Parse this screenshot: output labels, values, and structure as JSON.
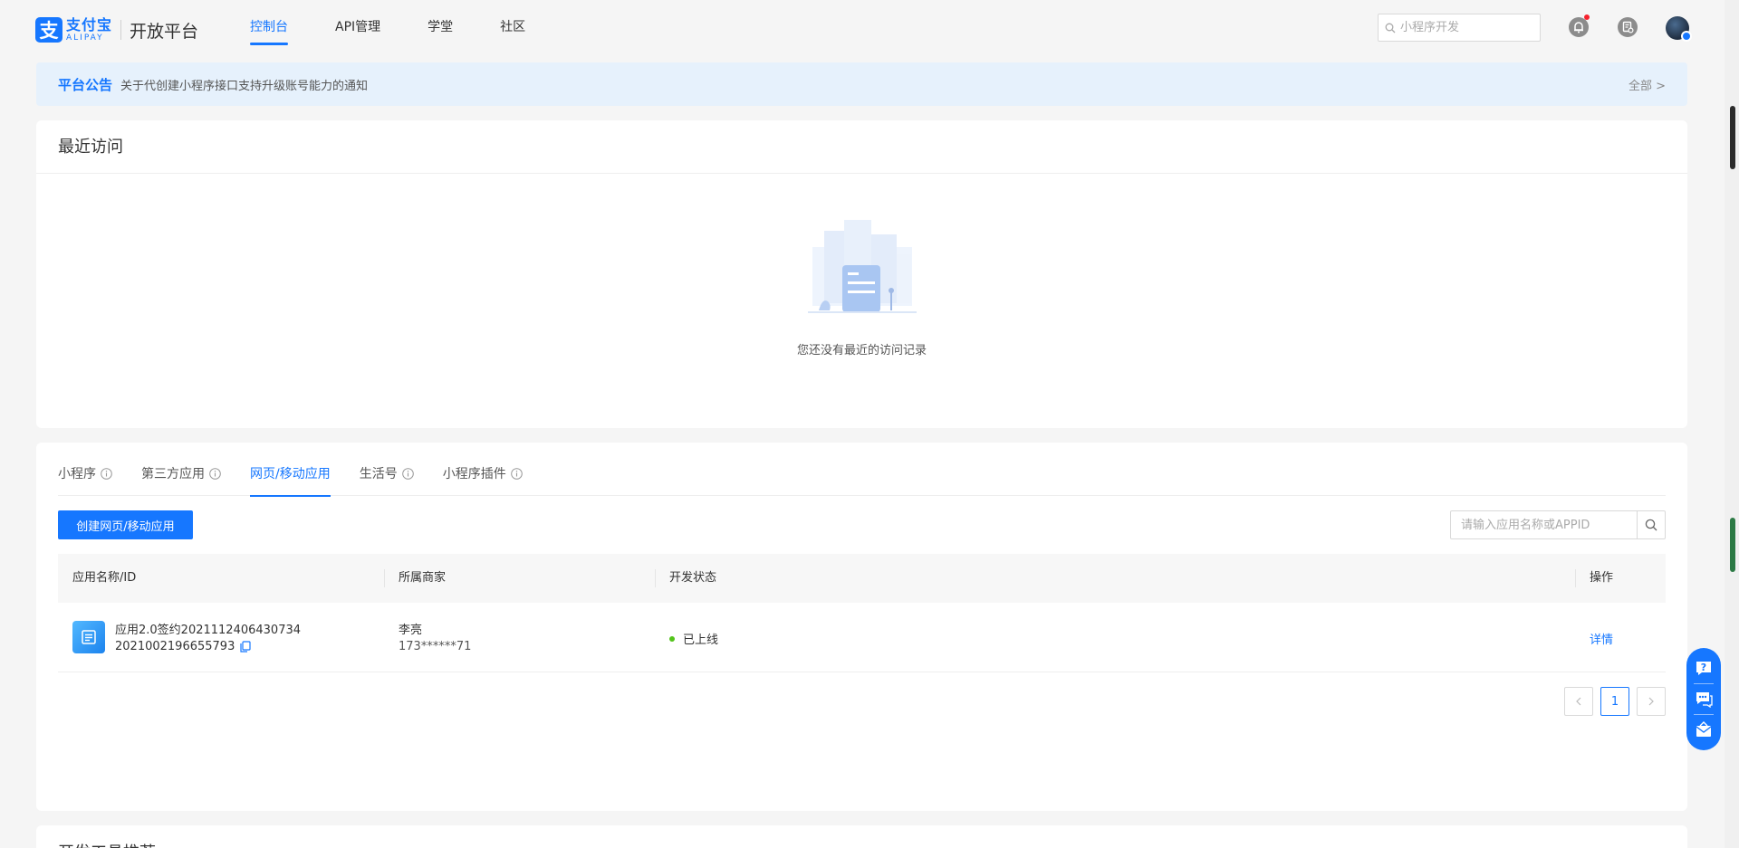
{
  "header": {
    "logo_cn": "支付宝",
    "logo_en": "ALIPAY",
    "logo_badge": "支",
    "platform": "开放平台",
    "nav": [
      {
        "label": "控制台",
        "active": true
      },
      {
        "label": "API管理",
        "active": false
      },
      {
        "label": "学堂",
        "active": false
      },
      {
        "label": "社区",
        "active": false
      }
    ],
    "search_placeholder": "小程序开发",
    "icons": [
      "bell-icon",
      "document-icon",
      "avatar"
    ]
  },
  "notice": {
    "label": "平台公告",
    "text": "关于代创建小程序接口支持升级账号能力的通知",
    "all": "全部 >"
  },
  "recent": {
    "title": "最近访问",
    "empty_text": "您还没有最近的访问记录"
  },
  "apps": {
    "tabs": [
      {
        "label": "小程序",
        "info": true,
        "active": false
      },
      {
        "label": "第三方应用",
        "info": true,
        "active": false
      },
      {
        "label": "网页/移动应用",
        "info": false,
        "active": true
      },
      {
        "label": "生活号",
        "info": true,
        "active": false
      },
      {
        "label": "小程序插件",
        "info": true,
        "active": false
      }
    ],
    "create_label": "创建网页/移动应用",
    "search_placeholder": "请输入应用名称或APPID",
    "columns": [
      "应用名称/ID",
      "所属商家",
      "开发状态",
      "操作"
    ],
    "rows": [
      {
        "name": "应用2.0签约2021112406430734",
        "id": "2021002196655793",
        "merchant": "李亮",
        "merchant_no": "173******71",
        "status": "已上线",
        "action": "详情"
      }
    ],
    "pagination": {
      "current": "1"
    }
  },
  "tools": {
    "title": "开发工具推荐"
  },
  "colors": {
    "primary": "#1677ff",
    "notice_bg": "#e6f1fc",
    "status_online": "#52c41a"
  }
}
